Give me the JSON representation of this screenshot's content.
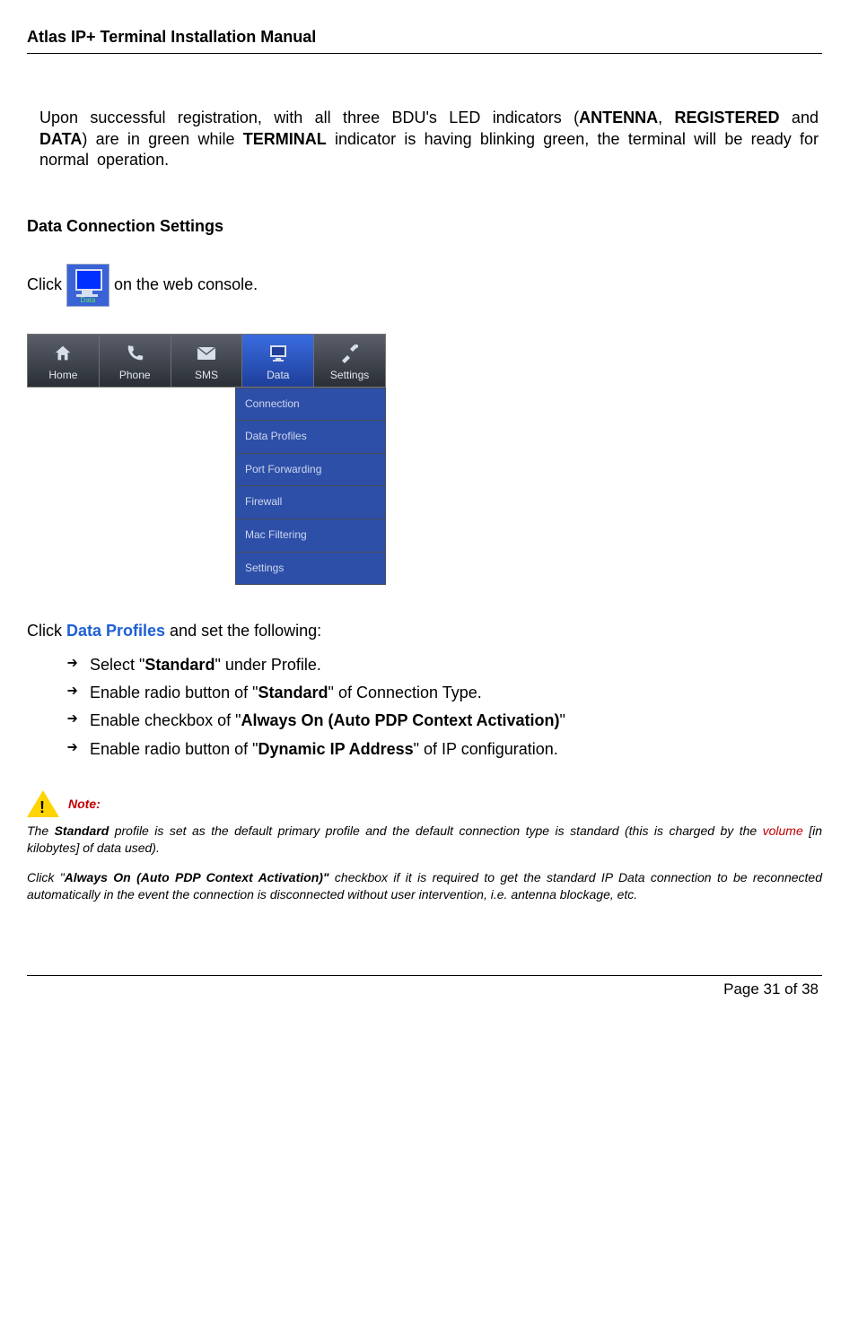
{
  "header": {
    "title": "Atlas IP+ Terminal Installation Manual"
  },
  "intro": {
    "pre": "Upon successful registration, with all three BDU's LED indicators (",
    "b1": "ANTENNA",
    "mid1": ", ",
    "b2": "REGISTERED",
    "mid2": " and ",
    "b3": "DATA",
    "mid3": ") are in green while ",
    "b4": "TERMINAL",
    "post": " indicator is having blinking green, the terminal will be ready for normal operation."
  },
  "section_heading": "Data Connection Settings",
  "click1": {
    "pre": "Click ",
    "icon_label": "Data",
    "post": " on the web console."
  },
  "nav": {
    "items": [
      "Home",
      "Phone",
      "SMS",
      "Data",
      "Settings"
    ],
    "active_index": 3,
    "dropdown": [
      "Connection",
      "Data Profiles",
      "Port Forwarding",
      "Firewall",
      "Mac Filtering",
      "Settings"
    ]
  },
  "click2": {
    "pre": "Click ",
    "link": "Data Profiles",
    "post": " and set the following:"
  },
  "bullets": [
    {
      "pre": "Select \"",
      "b": "Standard",
      "post": "\" under Profile."
    },
    {
      "pre": "Enable radio button of \"",
      "b": "Standard",
      "post": "\" of Connection Type."
    },
    {
      "pre": "Enable checkbox of \"",
      "b": "Always On (Auto PDP Context Activation)",
      "post": "\""
    },
    {
      "pre": "Enable radio button of \"",
      "b": "Dynamic IP Address",
      "post": "\" of IP configuration."
    }
  ],
  "note": {
    "label": "Note:",
    "p1": {
      "pre": "The ",
      "b": "Standard",
      "mid": " profile is set as the default primary profile and the default connection type is standard (this is charged by the ",
      "red": "volume",
      "post": " [in kilobytes] of data used)."
    },
    "p2": {
      "pre": "Click \"",
      "b": "Always On (Auto PDP Context Activation)\"",
      "post": " checkbox if it is required to get the standard IP Data connection to be reconnected automatically in the event the connection is disconnected without user intervention, i.e. antenna blockage, etc."
    }
  },
  "footer": {
    "text": "Page 31 of 38"
  }
}
